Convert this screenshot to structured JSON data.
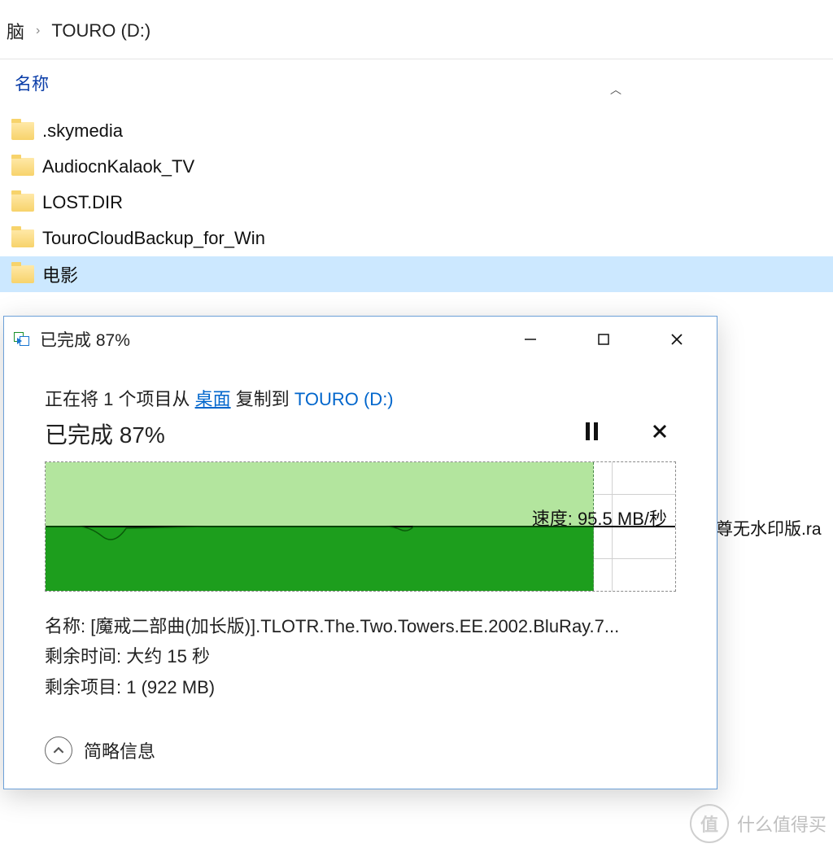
{
  "breadcrumb": {
    "parent": "脑",
    "separator": "›",
    "current": "TOURO (D:)"
  },
  "columns": {
    "name_header": "名称"
  },
  "files": [
    {
      "name": ".skymedia"
    },
    {
      "name": "AudiocnKalaok_TV"
    },
    {
      "name": "LOST.DIR"
    },
    {
      "name": "TouroCloudBackup_for_Win"
    },
    {
      "name": "电影"
    }
  ],
  "behind_text": "尊无水印版.ra",
  "dialog": {
    "title": "已完成 87%",
    "status_prefix": "正在将 1 个项目从 ",
    "source": "桌面",
    "status_mid": " 复制到 ",
    "destination": "TOURO (D:)",
    "progress_text": "已完成 87%",
    "progress_pct": 87,
    "speed_label": "速度: 95.5 MB/秒",
    "name_label": "名称:",
    "name_value": "[魔戒二部曲(加长版)].TLOTR.The.Two.Towers.EE.2002.BluRay.7...",
    "time_label": "剩余时间:",
    "time_value": "大约 15 秒",
    "items_label": "剩余项目:",
    "items_value": "1 (922 MB)",
    "toggle_text": "简略信息"
  },
  "watermark": {
    "logo": "值",
    "text": "什么值得买"
  }
}
